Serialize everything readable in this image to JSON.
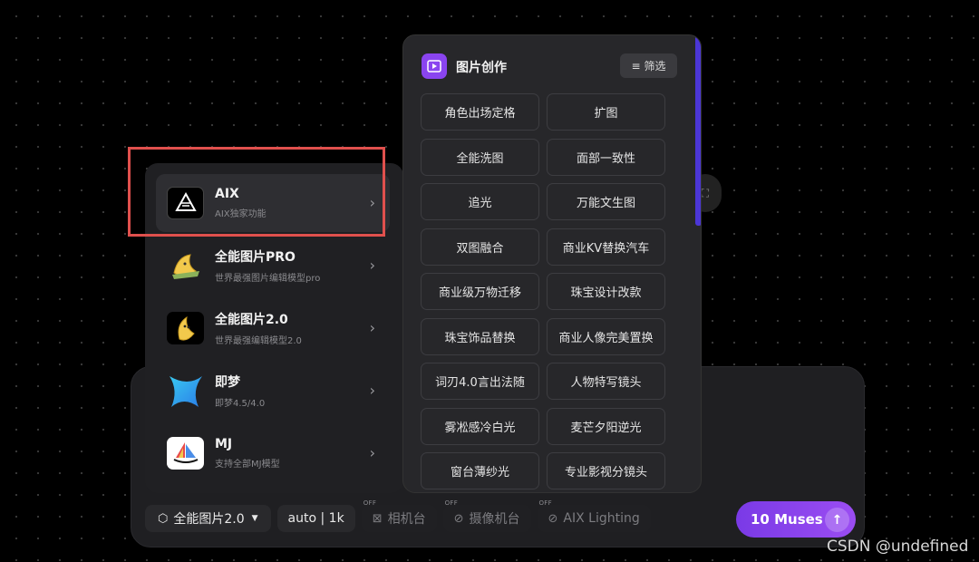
{
  "models": [
    {
      "name": "AIX",
      "desc": "AIX独家功能",
      "logo_text": "AIX",
      "active": true
    },
    {
      "name": "全能图片PRO",
      "desc": "世界最强图片编辑模型pro",
      "active": false
    },
    {
      "name": "全能图片2.0",
      "desc": "世界最强编辑模型2.0",
      "active": false
    },
    {
      "name": "即梦",
      "desc": "即梦4.5/4.0",
      "active": false
    },
    {
      "name": "MJ",
      "desc": "支持全部MJ模型",
      "active": false
    }
  ],
  "creation": {
    "title": "图片创作",
    "filter_label": "筛选",
    "items": [
      "角色出场定格",
      "扩图",
      "全能洗图",
      "面部一致性",
      "追光",
      "万能文生图",
      "双图融合",
      "商业KV替换汽车",
      "商业级万物迁移",
      "珠宝设计改款",
      "珠宝饰品替换",
      "商业人像完美置换",
      "词刃4.0言出法随",
      "人物特写镜头",
      "雾凇感冷白光",
      "麦芒夕阳逆光",
      "窗台薄纱光",
      "专业影视分镜头"
    ]
  },
  "bottom_bar": {
    "model_select": "全能图片2.0",
    "size": "auto | 1k",
    "off_tag": "OFF",
    "camera_stage": "相机台",
    "camera_rig": "摄像机台",
    "lighting": "AIX Lighting"
  },
  "send": {
    "label": "10 Muses"
  },
  "colors": {
    "accent": "#8a44f0",
    "highlight": "#e0504d",
    "scrollbar": "#4b36d6"
  },
  "watermark": "CSDN @undefined"
}
